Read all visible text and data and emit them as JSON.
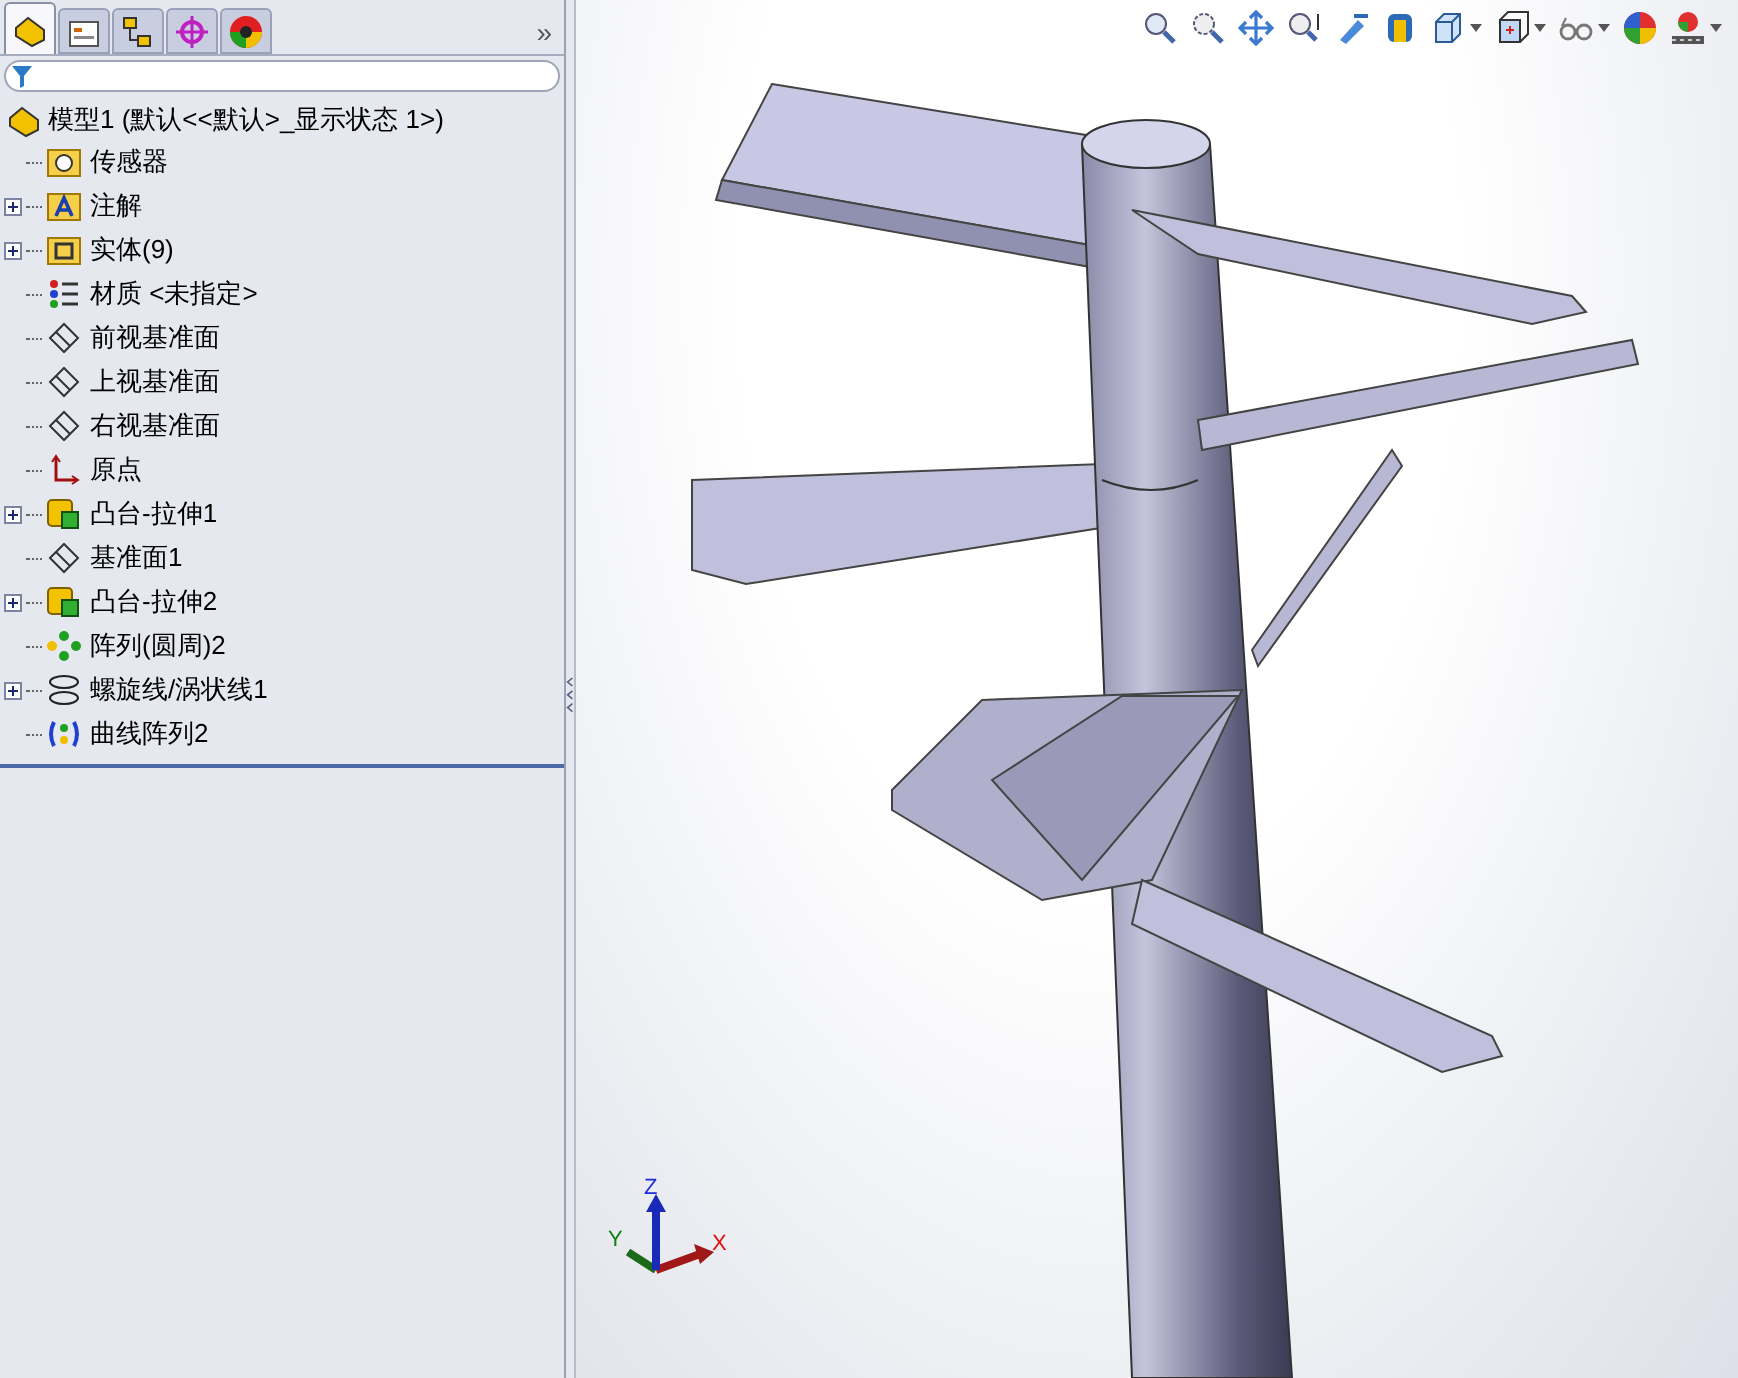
{
  "panel_tabs": [
    {
      "kind": "feature-tree",
      "selected": true
    },
    {
      "kind": "property",
      "selected": false
    },
    {
      "kind": "configuration",
      "selected": false
    },
    {
      "kind": "dimension",
      "selected": false
    },
    {
      "kind": "display",
      "selected": false
    }
  ],
  "panel_more": "»",
  "tree": {
    "root": {
      "label": "模型1 (默认<<默认>_显示状态 1>)"
    },
    "children": [
      {
        "kind": "sensor",
        "label": "传感器",
        "expandable": false
      },
      {
        "kind": "annotation",
        "label": "注解",
        "expandable": true
      },
      {
        "kind": "solid",
        "label": "实体(9)",
        "expandable": true
      },
      {
        "kind": "material",
        "label": "材质 <未指定>",
        "expandable": false
      },
      {
        "kind": "plane",
        "label": "前视基准面",
        "expandable": false
      },
      {
        "kind": "plane",
        "label": "上视基准面",
        "expandable": false
      },
      {
        "kind": "plane",
        "label": "右视基准面",
        "expandable": false
      },
      {
        "kind": "origin",
        "label": "原点",
        "expandable": false
      },
      {
        "kind": "extrude",
        "label": "凸台-拉伸1",
        "expandable": true
      },
      {
        "kind": "plane",
        "label": "基准面1",
        "expandable": false
      },
      {
        "kind": "extrude",
        "label": "凸台-拉伸2",
        "expandable": true
      },
      {
        "kind": "pattern",
        "label": "阵列(圆周)2",
        "expandable": false
      },
      {
        "kind": "helix",
        "label": "螺旋线/涡状线1",
        "expandable": true
      },
      {
        "kind": "curve-pattern",
        "label": "曲线阵列2",
        "expandable": false
      }
    ]
  },
  "triad": {
    "x": "X",
    "y": "Y",
    "z": "Z"
  }
}
